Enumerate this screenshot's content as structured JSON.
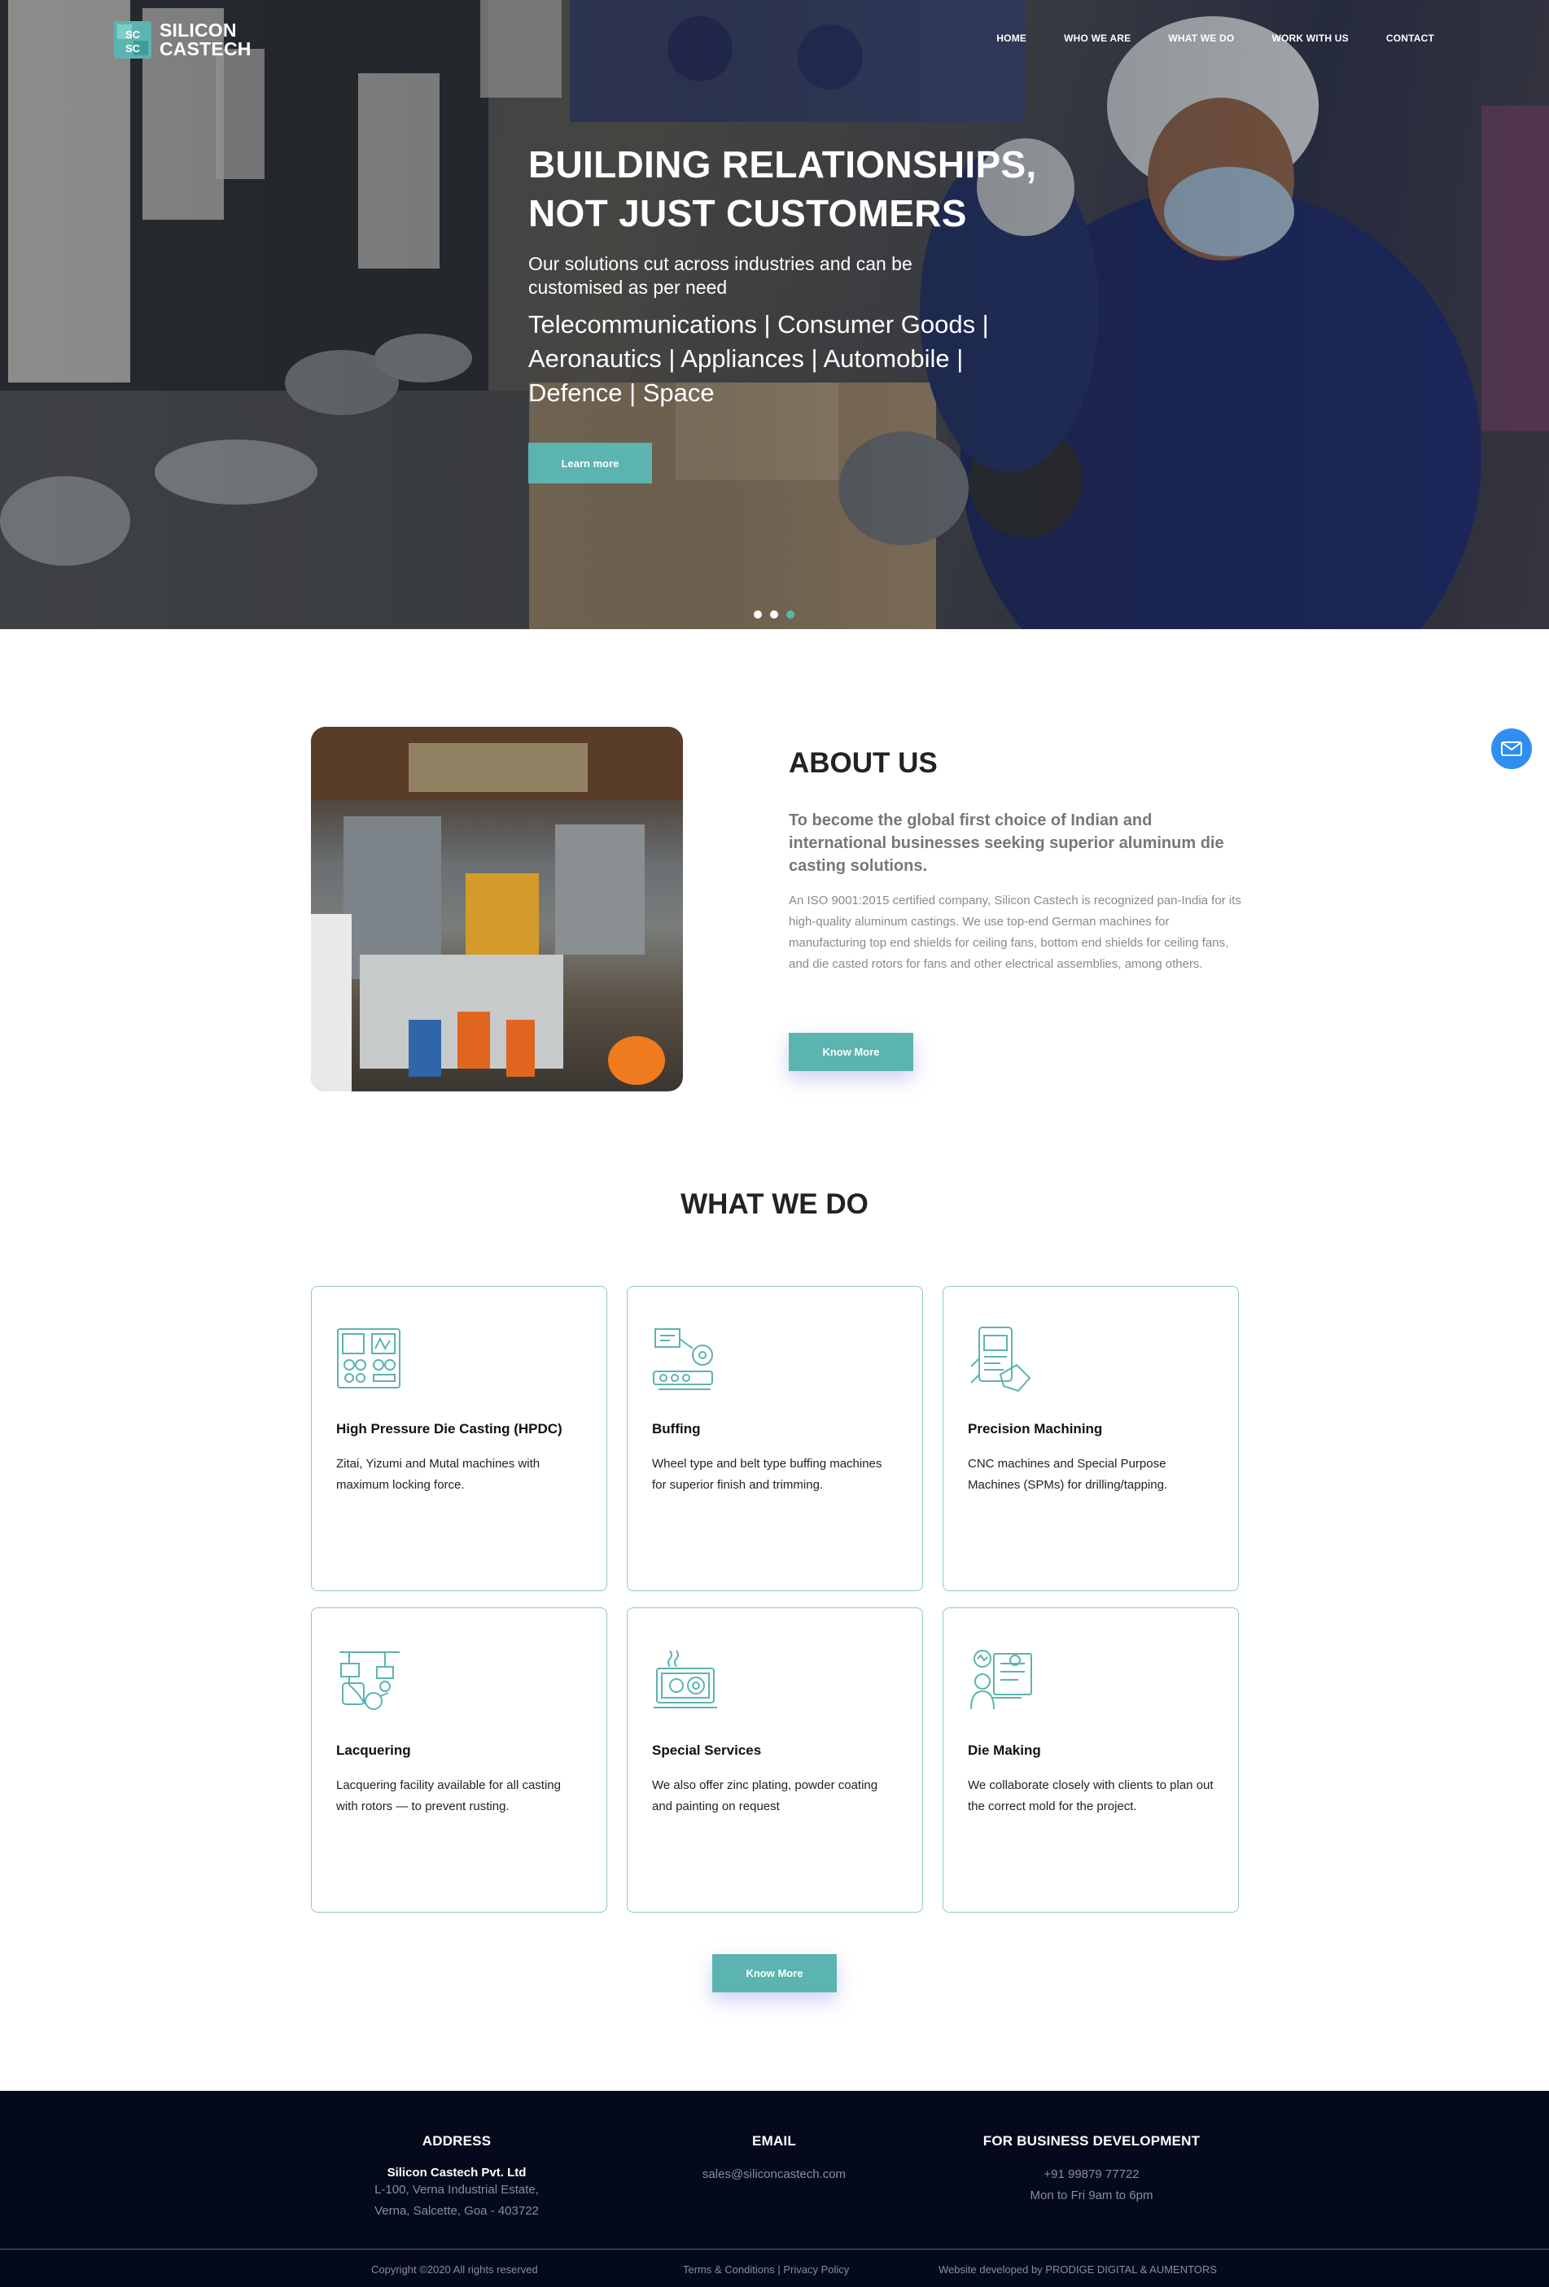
{
  "brand": {
    "line1": "SILICON",
    "line2": "CASTECH",
    "accent": "#5cb4b0"
  },
  "nav": {
    "items": [
      "HOME",
      "WHO WE ARE",
      "WHAT WE DO",
      "WORK WITH US",
      "CONTACT"
    ]
  },
  "hero": {
    "title_line1": "BUILDING RELATIONSHIPS,",
    "title_line2": "NOT JUST CUSTOMERS",
    "subtitle": "Our solutions cut across industries and can be customised as per need",
    "industries": "Telecommunications | Consumer Goods | Aeronautics | Appliances | Automobile | Defence | Space",
    "button": "Learn more",
    "slides": 3,
    "active_slide": 3
  },
  "about": {
    "title": "ABOUT US",
    "tagline": "To become the global first choice of Indian and international businesses seeking superior aluminum die casting solutions.",
    "body": "An ISO 9001:2015 certified company, Silicon Castech is recognized pan-India for its high-quality aluminum castings. We use top-end German machines for manufacturing top end shields for ceiling fans, bottom end shields for ceiling fans, and die casted rotors for fans and other electrical assemblies, among others.",
    "button": "Know More"
  },
  "what_we_do": {
    "title": "WHAT WE DO",
    "cards": [
      {
        "icon": "control-panel-icon",
        "title": "High Pressure Die Casting (HPDC)",
        "text": "Zitai, Yizumi and Mutal machines with maximum locking force."
      },
      {
        "icon": "buffing-machine-icon",
        "title": "Buffing",
        "text": "Wheel type and belt type buffing machines for superior finish and trimming."
      },
      {
        "icon": "tablet-hand-icon",
        "title": "Precision Machining",
        "text": "CNC machines and Special Purpose Machines (SPMs) for drilling/tapping."
      },
      {
        "icon": "spray-robot-icon",
        "title": "Lacquering",
        "text": "Lacquering facility available for all casting with rotors — to prevent rusting."
      },
      {
        "icon": "laptop-settings-icon",
        "title": "Special Services",
        "text": "We also offer zinc plating, powder coating and painting on request"
      },
      {
        "icon": "engineer-plan-icon",
        "title": "Die Making",
        "text": "We collaborate closely with clients to plan out the correct mold for the project."
      }
    ],
    "button": "Know More"
  },
  "footer": {
    "address": {
      "heading": "ADDRESS",
      "company": "Silicon Castech Pvt. Ltd",
      "line1": "L-100, Verna Industrial Estate,",
      "line2": "Verna, Salcette, Goa - 403722"
    },
    "email": {
      "heading": "EMAIL",
      "value": "sales@siliconcastech.com"
    },
    "business": {
      "heading": "FOR BUSINESS DEVELOPMENT",
      "phone": "+91 99879 77722",
      "hours": "Mon to Fri 9am to 6pm"
    },
    "copyright": "Copyright ©2020 All rights reserved",
    "terms": "Terms & Conditions",
    "separator": "|",
    "privacy": "Privacy Policy",
    "credit": "Website developed by PRODIGE DIGITAL & AUMENTORS"
  }
}
